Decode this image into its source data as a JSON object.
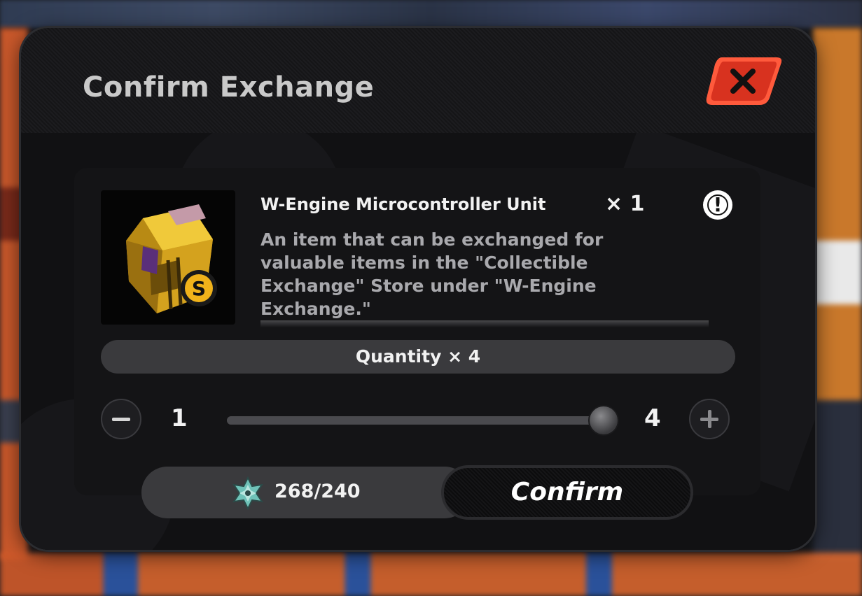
{
  "dialog": {
    "title": "Confirm Exchange"
  },
  "item": {
    "name": "W-Engine Microcontroller Unit",
    "quantity": "× 1",
    "info_icon": "!",
    "description": "An item that can be exchanged for valuable items in the \"Collectible Exchange\" Store under \"W-Engine Exchange.\""
  },
  "quantity_selector": {
    "label": "Quantity × 4",
    "min": "1",
    "max": "4",
    "current": 4,
    "range": [
      1,
      4
    ]
  },
  "footer": {
    "cost": "268/240",
    "confirm_label": "Confirm"
  },
  "icons": {
    "close": "close-icon",
    "info": "info-icon",
    "minus": "minus-icon",
    "plus": "plus-icon",
    "currency": "residual-currency-icon",
    "item": "w-engine-chest-icon"
  },
  "colors": {
    "close_button": "#e2402a",
    "item_gold": "#d4a21e",
    "text_primary": "#f2f2f2",
    "text_secondary": "#a9a9ad"
  }
}
